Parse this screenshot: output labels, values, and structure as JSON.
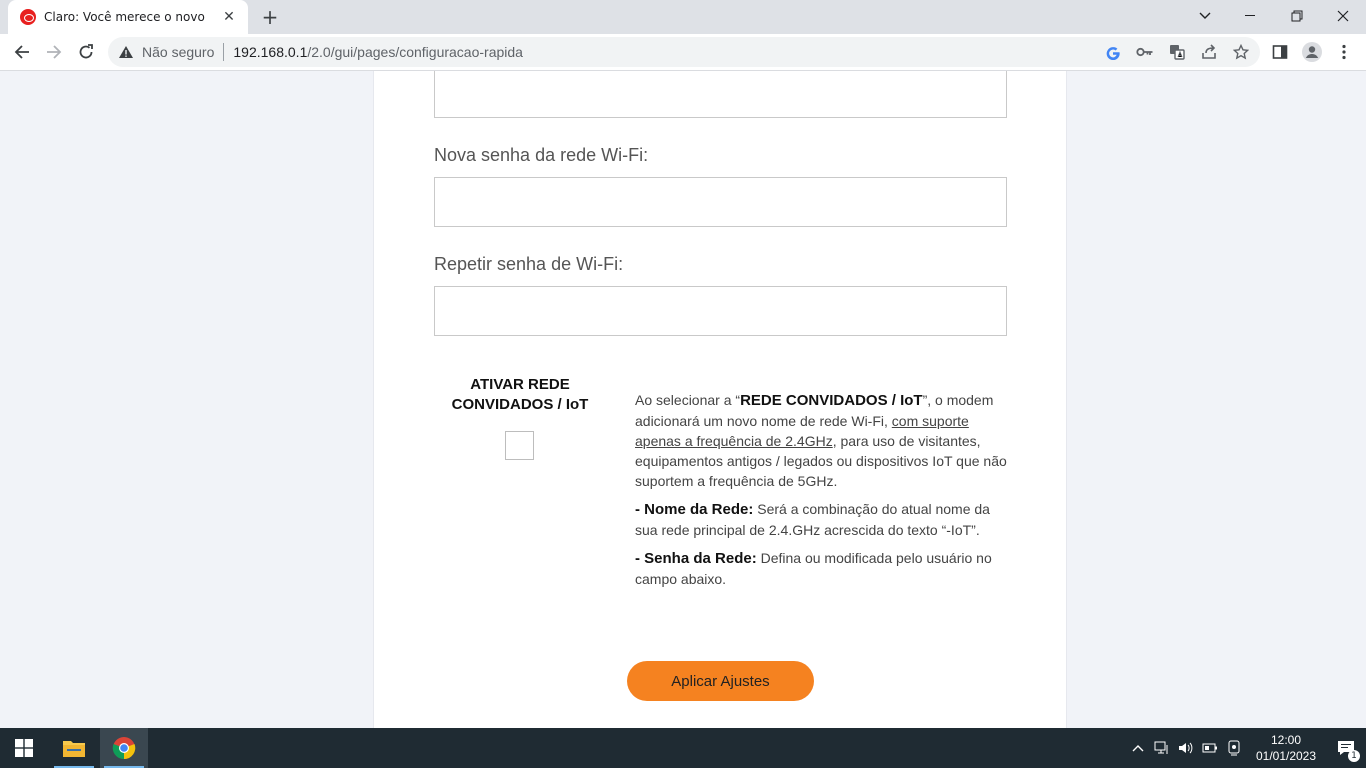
{
  "browser": {
    "tab_title": "Claro: Você merece o novo",
    "security_label": "Não seguro",
    "url_host": "192.168.0.1",
    "url_path": "/2.0/gui/pages/configuracao-rapida"
  },
  "form": {
    "new_password_label": "Nova senha da rede Wi-Fi:",
    "repeat_password_label": "Repetir senha de Wi-Fi:",
    "iot_title_line1": "ATIVAR REDE",
    "iot_title_line2": "CONVIDADOS / IoT",
    "desc": {
      "p1_a": "Ao selecionar a “",
      "p1_b": "REDE CONVIDADOS / IoT",
      "p1_c": "”, o modem adicionará um novo nome de rede Wi-Fi, ",
      "p1_d": "com suporte apenas a frequência de 2.4GHz",
      "p1_e": ", para uso de visitantes, equipamentos antigos / legados ou dispositivos IoT que não suportem a frequência de 5GHz.",
      "p2_a": "- Nome da Rede:",
      "p2_b": " Será a combinação do atual nome da sua rede principal de 2.4.GHz acrescida do texto “-IoT”.",
      "p3_a": "- Senha da Rede:",
      "p3_b": " Defina ou modificada pelo usuário no campo abaixo."
    },
    "apply_label": "Aplicar Ajustes",
    "accent_color": "#f58220"
  },
  "taskbar": {
    "time": "12:00",
    "date": "01/01/2023",
    "notification_count": "1"
  }
}
